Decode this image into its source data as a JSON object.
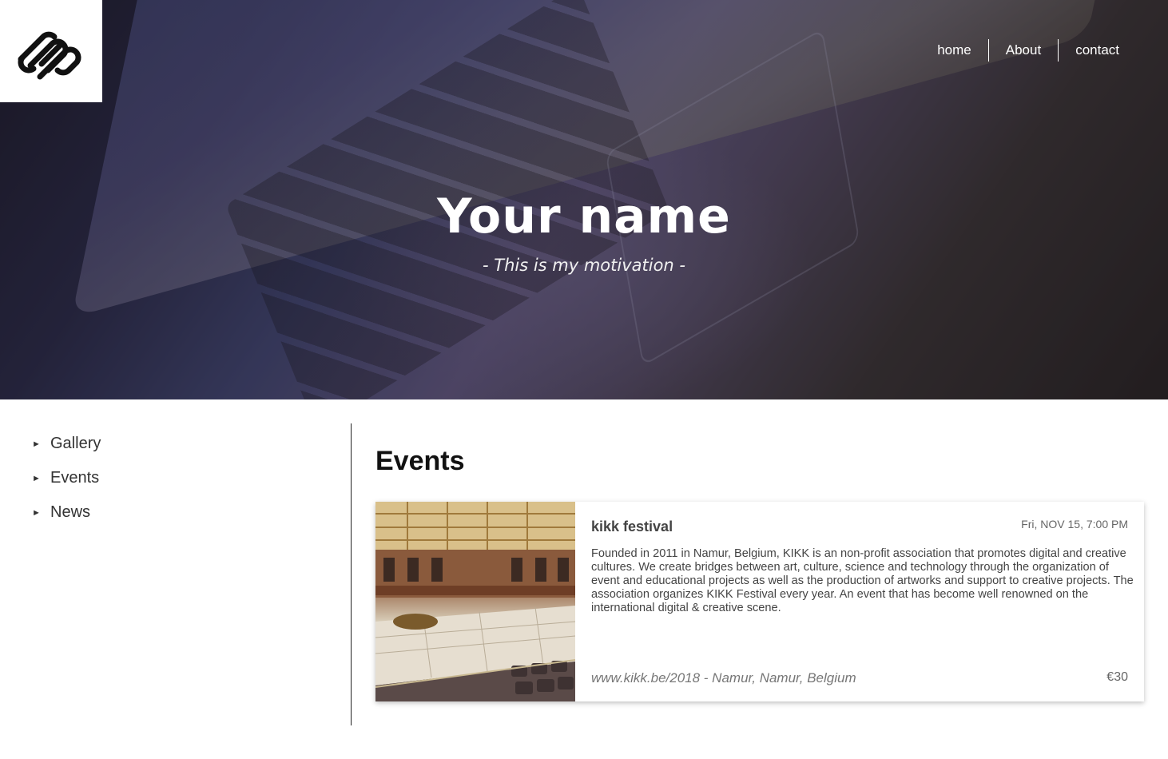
{
  "header": {
    "nav": [
      {
        "label": "home"
      },
      {
        "label": "About"
      },
      {
        "label": "contact"
      }
    ],
    "title": "Your name",
    "subtitle": "- This is my motivation -"
  },
  "sidebar": {
    "items": [
      {
        "label": "Gallery"
      },
      {
        "label": "Events"
      },
      {
        "label": "News"
      }
    ]
  },
  "main": {
    "heading": "Events",
    "event": {
      "title": "kikk festival",
      "date": "Fri, NOV 15, 7:00 PM",
      "description": "Founded in 2011 in Namur, Belgium, KIKK is an non-profit association that promotes digital and creative cultures. We create bridges between art, culture, science and technology through the organization of event and educational projects as well as the production of artworks and support to creative projects. The association organizes KIKK Festival every year. An event that has become well renowned on the international digital & creative scene.",
      "location": "www.kikk.be/2018 - Namur, Namur, Belgium",
      "price": "€30"
    }
  },
  "icons": {
    "logo": "squarespace-logo-icon",
    "sidebar_bullet": "triangle-right-icon"
  },
  "colors": {
    "nav_text": "#ffffff",
    "sidebar_text": "#333333",
    "card_text": "#444444"
  }
}
